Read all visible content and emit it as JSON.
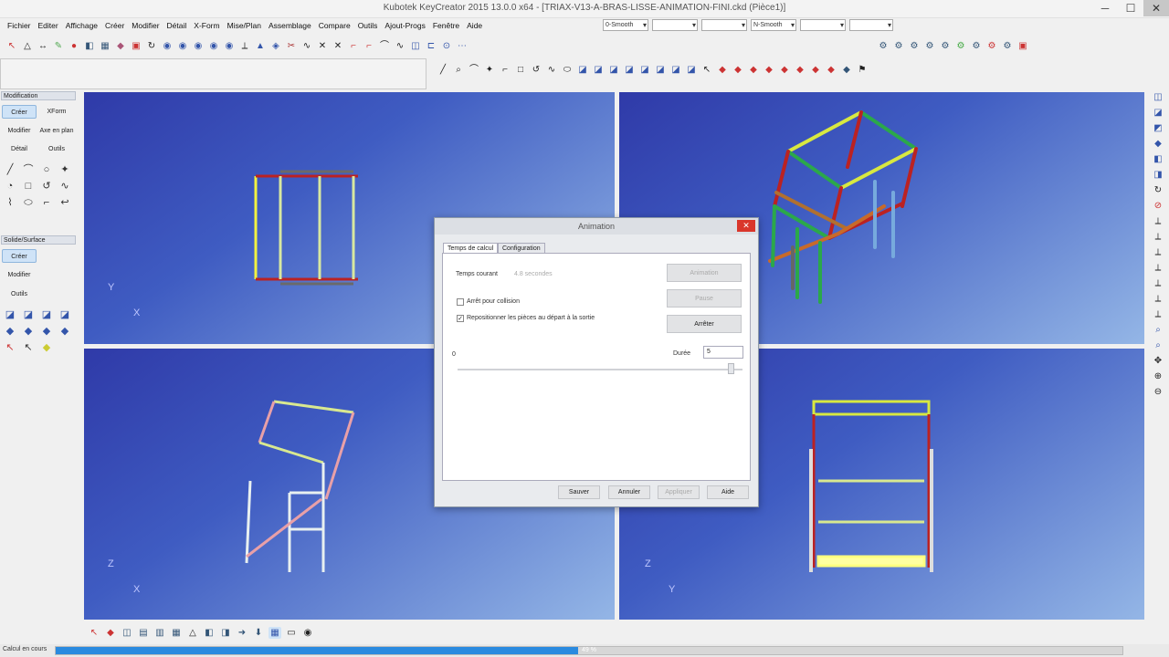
{
  "window": {
    "title": "Kubotek KeyCreator 2015 13.0.0 x64 - [TRIAX-V13-A-BRAS-LISSE-ANIMATION-FINI.ckd (Pièce1)]",
    "minimize": "─",
    "maximize": "☐",
    "close": "✕"
  },
  "menu": [
    "Fichier",
    "Editer",
    "Affichage",
    "Créer",
    "Modifier",
    "Détail",
    "X-Form",
    "Mise/Plan",
    "Assemblage",
    "Compare",
    "Outils",
    "Ajout-Progs",
    "Fenêtre",
    "Aide"
  ],
  "combos": {
    "smooth1": "0-Smooth",
    "smooth2": "N-Smooth"
  },
  "left_panel": {
    "modification": {
      "header": "Modification",
      "buttons": [
        "Créer",
        "XForm",
        "Modifier",
        "Axe en plan",
        "Détail",
        "Outils"
      ]
    },
    "solide": {
      "header": "Solide/Surface",
      "buttons": [
        "Créer",
        "Modifier",
        "Outils"
      ]
    }
  },
  "viewports": {
    "top_left": {
      "axis_v": "Y",
      "axis_h": "X"
    },
    "top_right": {},
    "bottom_left": {
      "axis_v": "Z",
      "axis_h": "X"
    },
    "bottom_right": {
      "axis_v": "Z",
      "axis_h": "Y"
    }
  },
  "dialog": {
    "title": "Animation",
    "close": "✕",
    "tabs": [
      "Temps de calcul",
      "Configuration"
    ],
    "current_time_label": "Temps courant",
    "current_time_value": "4.8 secondes",
    "animation_button": "Animation",
    "pause_button": "Pause",
    "stop_button": "Arrêter",
    "stop_on_collision": "Arrêt pour collision",
    "stop_on_collision_checked": false,
    "reset_parts": "Repositionner les pièces au départ à la sortie",
    "reset_parts_checked": true,
    "slider_min": "0",
    "duration_label": "Durée",
    "duration_value": "5",
    "footer": [
      "Sauver",
      "Annuler",
      "Appliquer",
      "Aide"
    ]
  },
  "status": {
    "text": "Calcul en cours",
    "progress_label": "49 %",
    "progress": 0.49
  },
  "colors": {
    "viewport_dark": "#2f3aa8",
    "viewport_light": "#94b6e6",
    "progress": "#2a8adf",
    "close_red": "#d9362b"
  }
}
